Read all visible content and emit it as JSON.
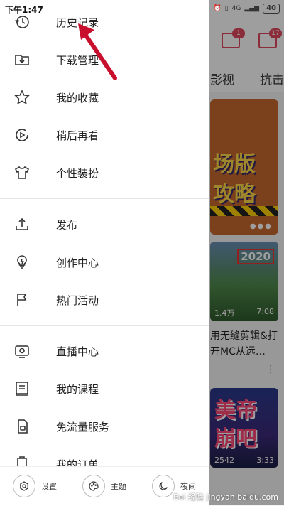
{
  "status_bar": {
    "time": "下午1:47",
    "network": "4G",
    "battery": "40"
  },
  "drawer": {
    "menu_groups": [
      [
        {
          "label": "历史记录",
          "icon": "history-clock-icon"
        },
        {
          "label": "下载管理",
          "icon": "download-folder-icon"
        },
        {
          "label": "我的收藏",
          "icon": "star-icon"
        },
        {
          "label": "稍后再看",
          "icon": "watch-later-icon"
        },
        {
          "label": "个性装扮",
          "icon": "shirt-icon"
        }
      ],
      [
        {
          "label": "发布",
          "icon": "upload-icon"
        },
        {
          "label": "创作中心",
          "icon": "lightbulb-icon"
        },
        {
          "label": "热门活动",
          "icon": "flag-icon"
        }
      ],
      [
        {
          "label": "直播中心",
          "icon": "live-tv-icon"
        },
        {
          "label": "我的课程",
          "icon": "course-book-icon"
        },
        {
          "label": "免流量服务",
          "icon": "sim-card-icon"
        },
        {
          "label": "我的订单",
          "icon": "order-icon"
        }
      ]
    ],
    "footer": {
      "settings_label": "设置",
      "theme_label": "主题",
      "night_label": "夜间"
    }
  },
  "background_app": {
    "download_badge": "1",
    "message_badge": "17",
    "tabs": [
      "影视",
      "抗击"
    ],
    "banner_lines": [
      "场版",
      "攻略"
    ],
    "video1": {
      "year_tag": "2020",
      "views": "1.4万",
      "duration": "7:08",
      "title": "用无缝剪辑&打开MC从远…"
    },
    "video2": {
      "overlay_text": [
        "美帝",
        "崩吧"
      ],
      "views": "2542",
      "duration": "3:33"
    }
  },
  "watermark": "Bai 经验 jingyan.baidu.com",
  "colors": {
    "accent": "#e0475f",
    "arrow": "#c8102e",
    "drawer_bg": "#ffffff"
  }
}
